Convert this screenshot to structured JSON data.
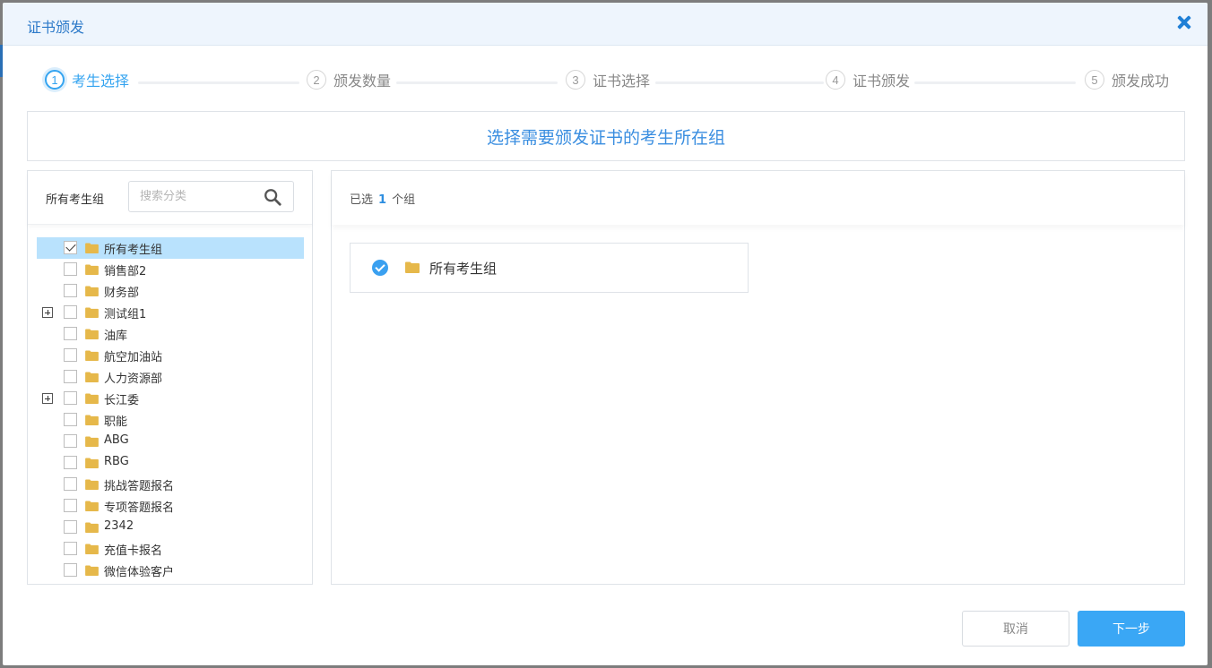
{
  "modal": {
    "title": "证书颁发"
  },
  "steps": [
    {
      "num": "1",
      "label": "考生选择",
      "active": true
    },
    {
      "num": "2",
      "label": "颁发数量",
      "active": false
    },
    {
      "num": "3",
      "label": "证书选择",
      "active": false
    },
    {
      "num": "4",
      "label": "证书颁发",
      "active": false
    },
    {
      "num": "5",
      "label": "颁发成功",
      "active": false
    }
  ],
  "banner": {
    "text": "选择需要颁发证书的考生所在组"
  },
  "left": {
    "header_label": "所有考生组",
    "search_placeholder": "搜索分类",
    "tree": [
      {
        "label": "所有考生组",
        "checked": true,
        "expandable": false,
        "selected": true
      },
      {
        "label": "销售部2",
        "checked": false,
        "expandable": false
      },
      {
        "label": "财务部",
        "checked": false,
        "expandable": false
      },
      {
        "label": "测试组1",
        "checked": false,
        "expandable": true
      },
      {
        "label": "油库",
        "checked": false,
        "expandable": false
      },
      {
        "label": "航空加油站",
        "checked": false,
        "expandable": false
      },
      {
        "label": "人力资源部",
        "checked": false,
        "expandable": false
      },
      {
        "label": "长江委",
        "checked": false,
        "expandable": true
      },
      {
        "label": "职能",
        "checked": false,
        "expandable": false
      },
      {
        "label": "ABG",
        "checked": false,
        "expandable": false
      },
      {
        "label": "RBG",
        "checked": false,
        "expandable": false
      },
      {
        "label": "挑战答题报名",
        "checked": false,
        "expandable": false
      },
      {
        "label": "专项答题报名",
        "checked": false,
        "expandable": false
      },
      {
        "label": "2342",
        "checked": false,
        "expandable": false
      },
      {
        "label": "充值卡报名",
        "checked": false,
        "expandable": false
      },
      {
        "label": "微信体验客户",
        "checked": false,
        "expandable": false
      }
    ]
  },
  "right": {
    "selected_prefix": "已选",
    "selected_count": "1",
    "selected_suffix": "个组",
    "chips": [
      {
        "label": "所有考生组"
      }
    ]
  },
  "footer": {
    "cancel_label": "取消",
    "next_label": "下一步"
  },
  "colors": {
    "accent": "#3aa7f5",
    "folder": "#e6b84a",
    "selected_row": "#b9e2fd"
  }
}
